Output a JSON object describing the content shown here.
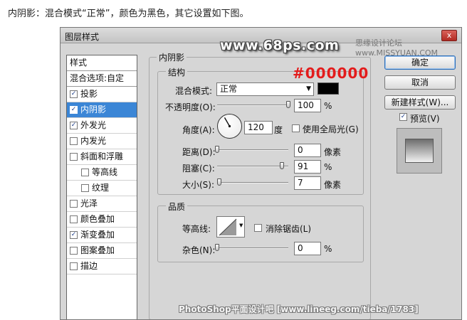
{
  "caption": "内阴影：混合模式“正常”，颜色为黑色，其它设置如下图。",
  "dialog": {
    "title": "图层样式",
    "close_glyph": "x"
  },
  "watermarks": {
    "site": "www.68ps.com",
    "forum": "思缘设计论坛  www.MISSYUAN.COM",
    "bottom": "PhotoShop平面设计吧 [www.lineeg.com/tieba/1783]"
  },
  "styles_panel": {
    "header": "样式",
    "blend_options": "混合选项:自定",
    "items": [
      {
        "label": "投影",
        "checked": true,
        "indent": 0,
        "selected": false
      },
      {
        "label": "内阴影",
        "checked": true,
        "indent": 0,
        "selected": true
      },
      {
        "label": "外发光",
        "checked": true,
        "indent": 0,
        "selected": false
      },
      {
        "label": "内发光",
        "checked": false,
        "indent": 0,
        "selected": false
      },
      {
        "label": "斜面和浮雕",
        "checked": false,
        "indent": 0,
        "selected": false
      },
      {
        "label": "等高线",
        "checked": false,
        "indent": 1,
        "selected": false
      },
      {
        "label": "纹理",
        "checked": false,
        "indent": 1,
        "selected": false
      },
      {
        "label": "光泽",
        "checked": false,
        "indent": 0,
        "selected": false
      },
      {
        "label": "颜色叠加",
        "checked": false,
        "indent": 0,
        "selected": false
      },
      {
        "label": "渐变叠加",
        "checked": true,
        "indent": 0,
        "selected": false
      },
      {
        "label": "图案叠加",
        "checked": false,
        "indent": 0,
        "selected": false
      },
      {
        "label": "描边",
        "checked": false,
        "indent": 0,
        "selected": false
      }
    ]
  },
  "inner_shadow": {
    "title": "内阴影",
    "structure": {
      "title": "结构",
      "color_hex_annotation": "#000000",
      "shadow_color": "#000000",
      "blend_mode_label": "混合模式:",
      "blend_mode_value": "正常",
      "opacity_label": "不透明度(O):",
      "opacity_value": "100",
      "opacity_unit": "%",
      "opacity_level": 100,
      "angle_label": "角度(A):",
      "angle_value": "120",
      "angle_unit": "度",
      "global_light_label": "使用全局光(G)",
      "global_light_checked": false,
      "distance_label": "距离(D):",
      "distance_value": "0",
      "distance_unit": "像素",
      "distance_level": 0,
      "choke_label": "阻塞(C):",
      "choke_value": "91",
      "choke_unit": "%",
      "choke_level": 91,
      "size_label": "大小(S):",
      "size_value": "7",
      "size_unit": "像素",
      "size_level": 3
    },
    "quality": {
      "title": "品质",
      "contour_label": "等高线:",
      "antialias_label": "消除锯齿(L)",
      "antialias_checked": false,
      "noise_label": "杂色(N):",
      "noise_value": "0",
      "noise_unit": "%",
      "noise_level": 0
    }
  },
  "buttons": {
    "ok": "确定",
    "cancel": "取消",
    "new_style": "新建样式(W)...",
    "preview_label": "预览(V)",
    "preview_checked": true
  }
}
